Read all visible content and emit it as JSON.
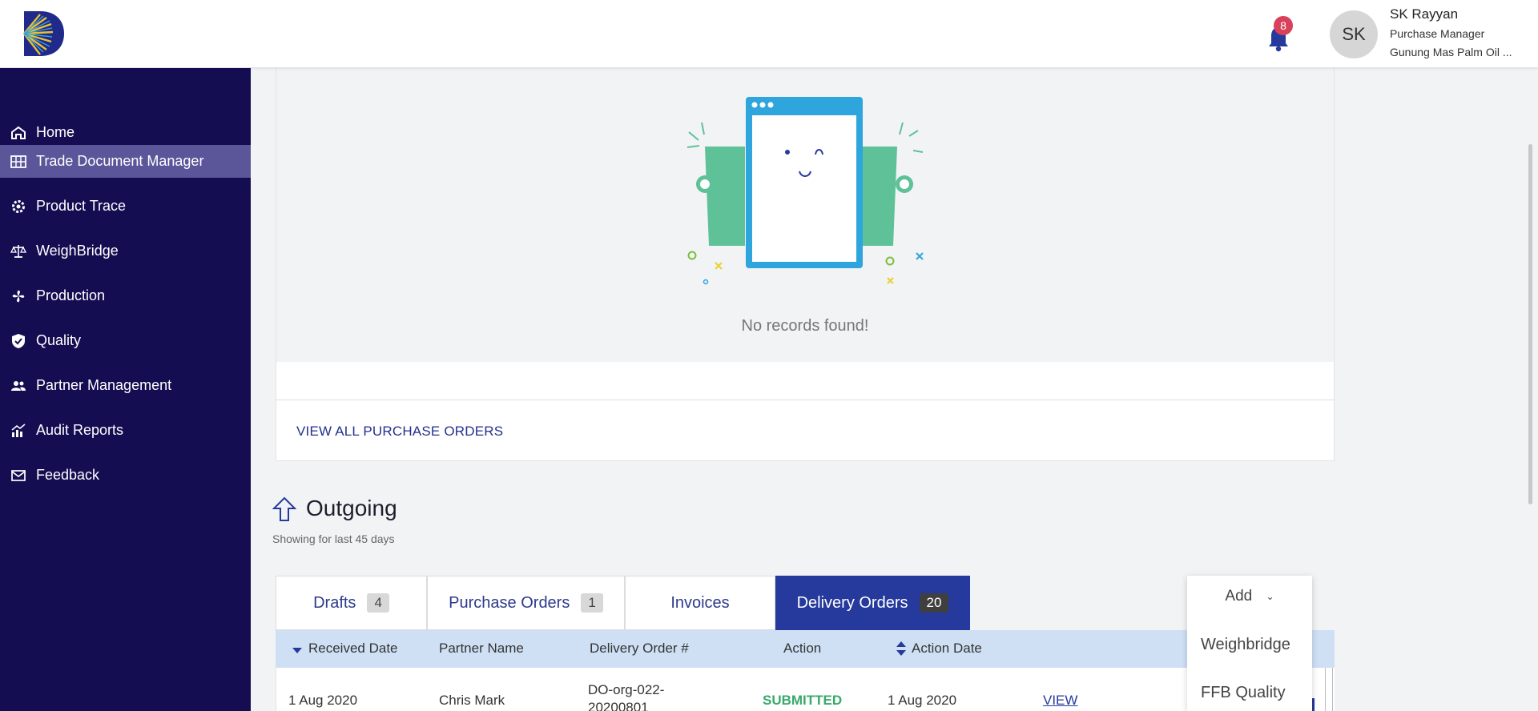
{
  "header": {
    "notifications_count": "8",
    "avatar_initials": "SK",
    "user_name": "SK Rayyan",
    "user_role": "Purchase Manager",
    "user_org": "Gunung Mas Palm Oil ..."
  },
  "sidebar": {
    "items": [
      {
        "label": "Home",
        "icon": "home-icon"
      },
      {
        "label": "Trade Document Manager",
        "icon": "document-grid-icon",
        "active": true
      },
      {
        "label": "Product Trace",
        "icon": "gear-icon"
      },
      {
        "label": "WeighBridge",
        "icon": "scale-icon"
      },
      {
        "label": "Production",
        "icon": "fan-icon"
      },
      {
        "label": "Quality",
        "icon": "shield-check-icon"
      },
      {
        "label": "Partner Management",
        "icon": "people-icon"
      },
      {
        "label": "Audit Reports",
        "icon": "chart-icon"
      },
      {
        "label": "Feedback",
        "icon": "mail-icon"
      }
    ]
  },
  "incoming": {
    "empty_text": "No records found!",
    "view_all_label": "VIEW ALL PURCHASE ORDERS"
  },
  "outgoing": {
    "title": "Outgoing",
    "subtitle": "Showing for last 45 days",
    "tabs": [
      {
        "label": "Drafts",
        "count": "4"
      },
      {
        "label": "Purchase Orders",
        "count": "1"
      },
      {
        "label": "Invoices",
        "count": ""
      },
      {
        "label": "Delivery Orders",
        "count": "20",
        "active": true
      }
    ],
    "columns": [
      "Received Date",
      "Partner Name",
      "Delivery Order #",
      "Action",
      "Action Date"
    ],
    "rows": [
      {
        "received_date": "1 Aug 2020",
        "partner_name": "Chris Mark",
        "delivery_order": "DO-org-022-20200801",
        "action": "SUBMITTED",
        "action_date": "1 Aug 2020",
        "view_label": "VIEW"
      }
    ]
  },
  "add_menu": {
    "label": "Add",
    "items": [
      "Weighbridge",
      "FFB Quality"
    ]
  },
  "colors": {
    "sidebar_bg": "#150d52",
    "sidebar_active": "#5b559a",
    "accent": "#253a9c",
    "submitted": "#3aa86b",
    "badge": "#d9405a"
  }
}
